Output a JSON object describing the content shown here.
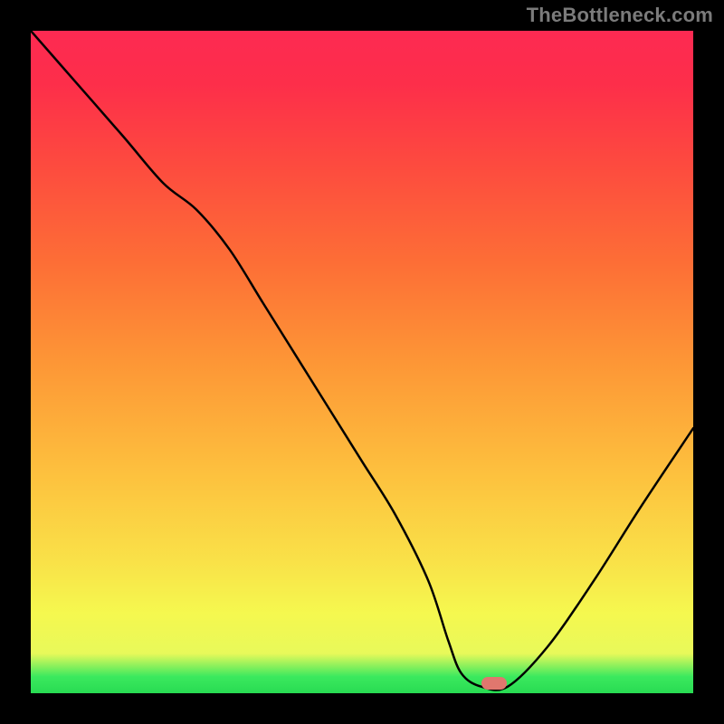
{
  "watermark": "TheBottleneck.com",
  "chart_data": {
    "type": "line",
    "title": "",
    "xlabel": "",
    "ylabel": "",
    "xlim": [
      0,
      100
    ],
    "ylim": [
      0,
      100
    ],
    "x": [
      0,
      7,
      14,
      20,
      25,
      30,
      35,
      40,
      45,
      50,
      55,
      60,
      63,
      65,
      68,
      72,
      78,
      85,
      92,
      100
    ],
    "values": [
      100,
      92,
      84,
      77,
      73,
      67,
      59,
      51,
      43,
      35,
      27,
      17,
      8,
      3,
      1,
      1,
      7,
      17,
      28,
      40
    ],
    "marker": {
      "x": 70,
      "y": 1.5
    },
    "gradient_colors": {
      "top": "#fd2a52",
      "mid": "#f9e148",
      "bottom": "#28db52"
    }
  }
}
